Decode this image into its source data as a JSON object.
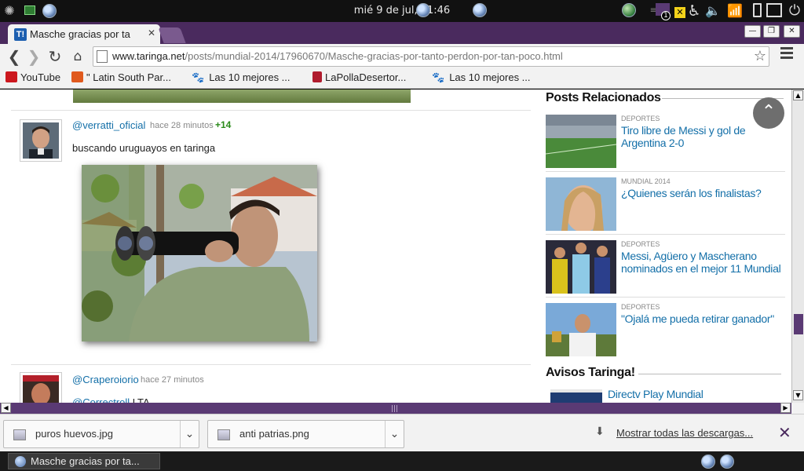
{
  "panel": {
    "clock": "mié  9 de jul, 21:46",
    "notification_count": "1"
  },
  "browser": {
    "tab_title": "Masche gracias por ta",
    "tab_favicon": "T!",
    "url_host": "www.taringa.net",
    "url_path": "/posts/mundial-2014/17960670/Masche-gracias-por-tanto-perdon-por-tan-poco.html"
  },
  "bookmarks": [
    {
      "label": "YouTube",
      "icon": "youtube-icon",
      "color": "#cc181e"
    },
    {
      "label": "\" Latin South Par...",
      "icon": "page-icon",
      "color": "#e05a1e"
    },
    {
      "label": "Las 10 mejores ...",
      "icon": "paw-icon",
      "color": "#111111"
    },
    {
      "label": "LaPollaDesertor...",
      "icon": "page-icon",
      "color": "#b01c2e"
    },
    {
      "label": "Las 10 mejores ...",
      "icon": "paw-icon",
      "color": "#111111"
    }
  ],
  "comments": [
    {
      "user": "@verratti_oficial",
      "ago": "hace 28 minutos",
      "score": "+14",
      "text": "buscando uruguayos en taringa"
    },
    {
      "user": "@Craperoiorio",
      "ago": "hace 27 minutos",
      "text_user": "@Correctroll",
      "text": " LTA"
    }
  ],
  "sidebar": {
    "related_title": "Posts Relacionados",
    "related": [
      {
        "category": "DEPORTES",
        "title": "Tiro libre de Messi y gol de Argentina 2-0"
      },
      {
        "category": "MUNDIAL 2014",
        "title": "¿Quienes serán los finalistas?"
      },
      {
        "category": "DEPORTES",
        "title": "Messi, Agüero y Mascherano nominados en el mejor 11 Mundial"
      },
      {
        "category": "DEPORTES",
        "title": "\"Ojalá me pueda retirar ganador\""
      }
    ],
    "ads_title": "Avisos Taringa!",
    "ads": [
      {
        "title": "Directv Play Mundial"
      }
    ]
  },
  "downloads": {
    "items": [
      {
        "name": "puros huevos.jpg"
      },
      {
        "name": "anti patrias.png"
      }
    ],
    "show_all": "Mostrar todas las descargas..."
  },
  "taskbar": {
    "window_title": "Masche gracias por ta..."
  },
  "colors": {
    "accent": "#4a2a5e",
    "link": "#136fa8",
    "score": "#2a8a1a"
  }
}
